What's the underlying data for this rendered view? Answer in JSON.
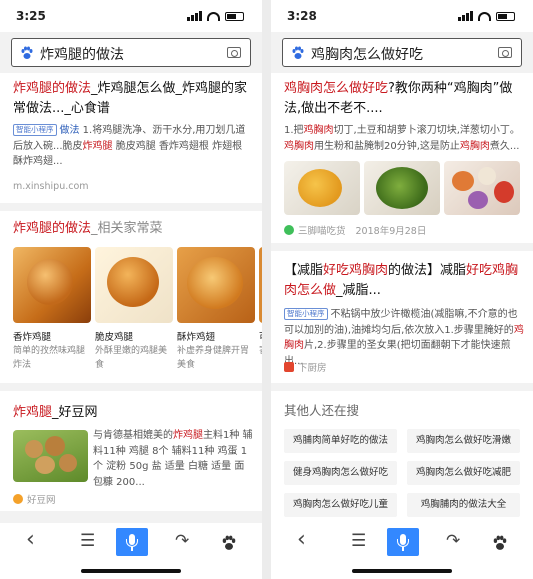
{
  "left": {
    "time": "3:25",
    "query": "炸鸡腿的做法",
    "r1": {
      "title_r1": "炸鸡腿的做法",
      "title_t1": "_炸鸡腿怎么做_炸鸡腿的家常做法..._心食谱",
      "tag": "智能小程序",
      "b_blue": "做法",
      "b1": " 1.将鸡腿洗净、沥干水分,用刀划几道后放入碗...脆皮",
      "b_r": "炸鸡腿",
      "b2": " 脆皮鸡腿 香炸鸡翅根 炸翅根 酥炸鸡翅...",
      "source": "m.xinshipu.com"
    },
    "r2": {
      "title_r": "炸鸡腿的做法",
      "title_g": "_相关家常菜",
      "items": [
        {
          "name": "香炸鸡腿",
          "desc": "简单的孜然味鸡腿炸法"
        },
        {
          "name": "脆皮鸡腿",
          "desc": "外酥里嫩的鸡腿美食"
        },
        {
          "name": "酥炸鸡翅",
          "desc": "补虚养身健脾开胃美食"
        },
        {
          "name": "可",
          "desc": "害"
        }
      ]
    },
    "r3": {
      "title_r": "炸鸡腿",
      "title_t": "_好豆网",
      "b1": "与肯德基相媲美的",
      "b_r": "炸鸡腿",
      "b2": "主料1种 辅料11种 鸡腿 8个 辅料11种 鸡蛋 1个 淀粉 50g 盐 适量 白糖 适量 面包糠 200...",
      "source": "好豆网"
    },
    "nav": {
      "back": "‹",
      "menu": "☰",
      "share": "↷"
    }
  },
  "right": {
    "time": "3:28",
    "query": "鸡胸肉怎么做好吃",
    "r1": {
      "title_r": "鸡胸肉怎么做好吃",
      "title_t": "?教你两种“鸡胸肉”做法,做出不老不....",
      "b1": "1.把",
      "b_r1": "鸡胸肉",
      "b2": "切丁,土豆和胡萝卜滚刀切块,洋葱切小丁。",
      "b_r2": "鸡胸肉",
      "b3": "用生粉和盐腌制20分钟,这是防止",
      "b_r3": "鸡胸肉",
      "b4": "煮久...",
      "source": "三脚喵吃货",
      "date": "2018年9月28日"
    },
    "r2": {
      "t1": "【减脂",
      "r1": "好吃鸡胸肉",
      "t2": "的做法】减脂",
      "r2": "好吃鸡胸肉怎么做",
      "t3": "_减脂...",
      "tag": "智能小程序",
      "b1": "不粘锅中放少许橄榄油(减脂嘛,不介意的也可以加別的油),油摊均匀后,依次放入1.步骤里腌好的",
      "b_r": "鸡胸肉",
      "b2": "片,2.步骤里的圣女果(把切面翻朝下才能快速煎出...",
      "source": "下厨房"
    },
    "others": {
      "heading": "其他人还在搜",
      "chips": [
        "鸡脯肉简单好吃的做法",
        "鸡胸肉怎么做好吃滑嫩",
        "健身鸡胸肉怎么做好吃",
        "鸡胸肉怎么做好吃减肥",
        "鸡胸肉怎么做好吃儿童",
        "鸡胸脯肉的做法大全"
      ]
    },
    "nav": {
      "back": "‹",
      "menu": "☰",
      "share": "↷"
    }
  }
}
